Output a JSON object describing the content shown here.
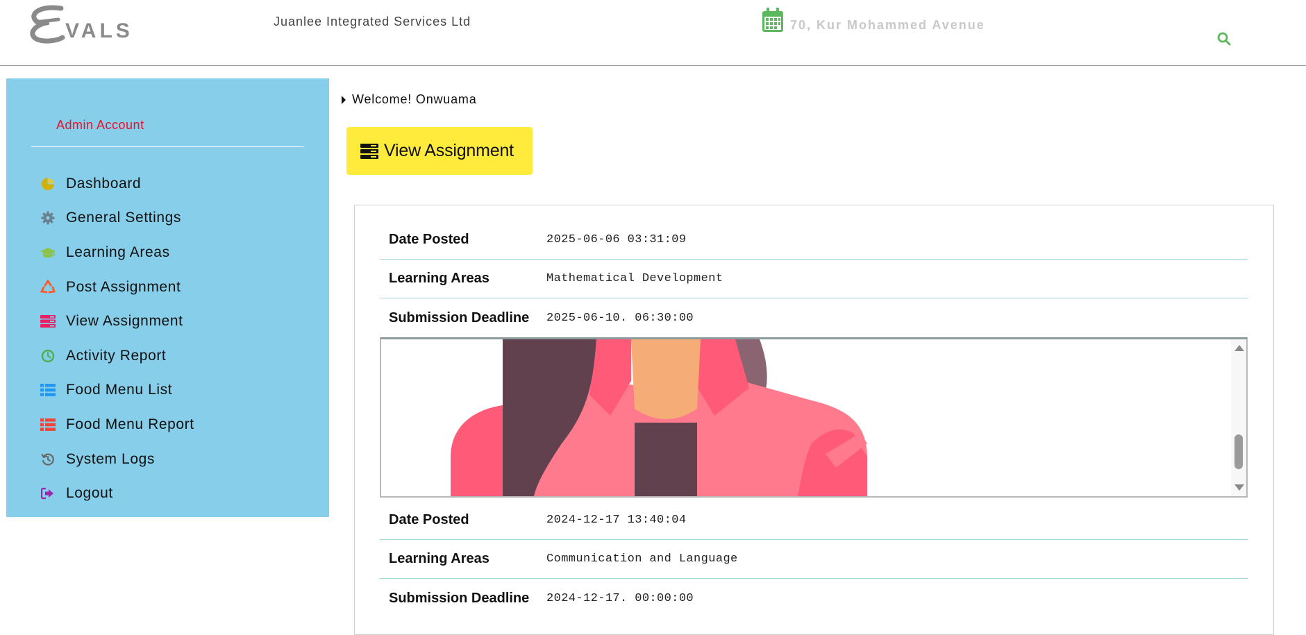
{
  "header": {
    "logo_text": "EVALS",
    "org_name": "Juanlee Integrated Services Ltd",
    "address": "70, Kur Mohammed Avenue",
    "search_icon": "search-icon",
    "colors": {
      "accent_green": "#5cb85c",
      "logo_grey": "#8a8a8a"
    }
  },
  "sidebar": {
    "account_label": "Admin Account",
    "background": "#87ceea",
    "items": [
      {
        "label": "Dashboard",
        "icon": "pie-chart-icon",
        "color": "#d4b000"
      },
      {
        "label": "General Settings",
        "icon": "gear-icon",
        "color": "#6b7f8e"
      },
      {
        "label": "Learning Areas",
        "icon": "graduation-cap-icon",
        "color": "#8bc34a"
      },
      {
        "label": "Post Assignment",
        "icon": "recycle-icon",
        "color": "#ff5722"
      },
      {
        "label": "View Assignment",
        "icon": "server-icon",
        "color": "#e91e63"
      },
      {
        "label": "Activity Report",
        "icon": "clock-icon",
        "color": "#4caf50"
      },
      {
        "label": "Food Menu List",
        "icon": "list-icon",
        "color": "#2196f3"
      },
      {
        "label": "Food Menu Report",
        "icon": "list-icon",
        "color": "#f44336"
      },
      {
        "label": "System Logs",
        "icon": "history-icon",
        "color": "#666666"
      },
      {
        "label": "Logout",
        "icon": "sign-out-icon",
        "color": "#9c27b0"
      }
    ]
  },
  "main": {
    "welcome": "Welcome! Onwuama",
    "page_button": "View Assignment",
    "page_button_color": "#ffeb3b",
    "assignments": [
      {
        "date_posted_label": "Date Posted",
        "date_posted": "2025-06-06 03:31:09",
        "learning_areas_label": "Learning Areas",
        "learning_areas": "Mathematical Development",
        "deadline_label": "Submission Deadline",
        "deadline": "2025-06-10. 06:30:00"
      },
      {
        "date_posted_label": "Date Posted",
        "date_posted": "2024-12-17 13:40:04",
        "learning_areas_label": "Learning Areas",
        "learning_areas": "Communication and Language",
        "deadline_label": "Submission Deadline",
        "deadline": "2024-12-17. 00:00:00"
      }
    ]
  }
}
